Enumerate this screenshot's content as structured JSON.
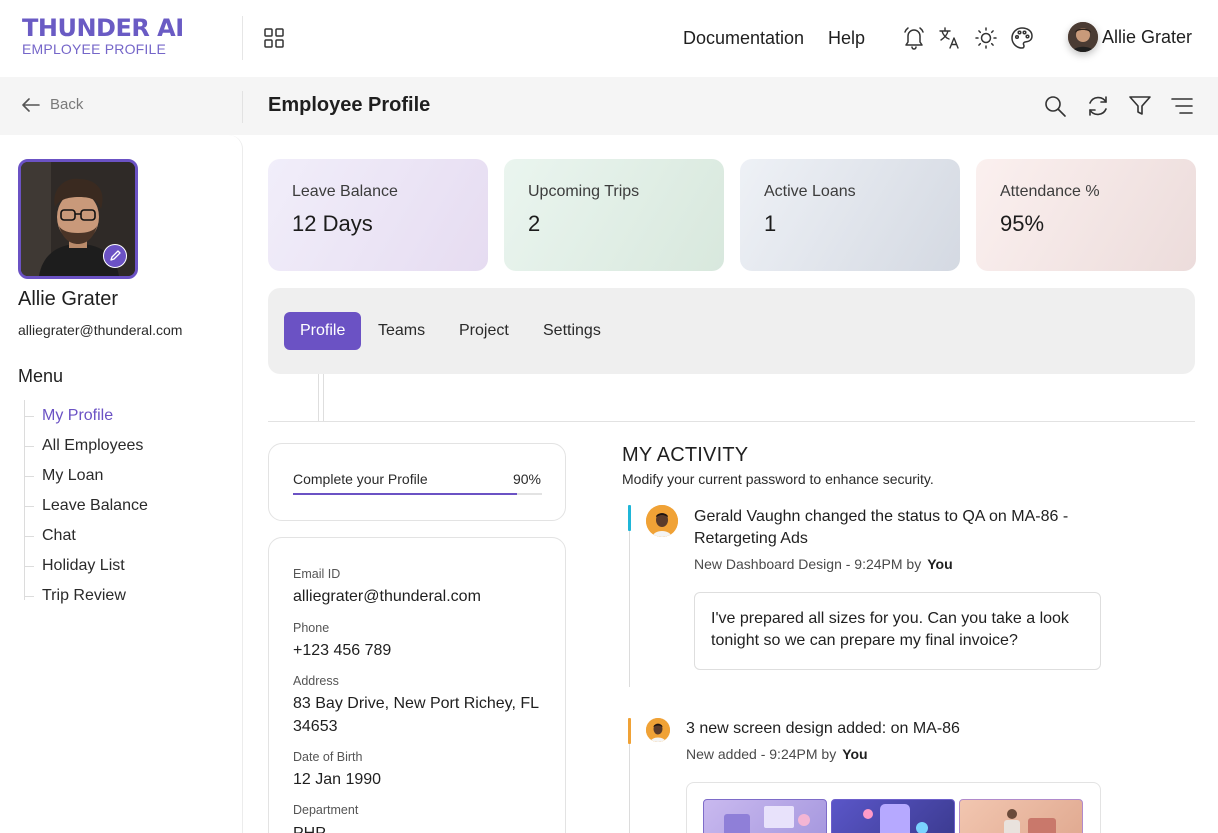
{
  "brand": {
    "title": "THUNDER AI",
    "subtitle": "EMPLOYEE PROFILE"
  },
  "header": {
    "nav": [
      "Documentation",
      "Help"
    ],
    "icons": [
      "notification-icon",
      "translate-icon",
      "sun-icon",
      "palette-icon"
    ],
    "user_name": "Allie Grater"
  },
  "subheader": {
    "back_label": "Back",
    "title": "Employee Profile",
    "icons": [
      "search-icon",
      "refresh-icon",
      "filter-icon",
      "menu-icon"
    ]
  },
  "sidebar": {
    "name": "Allie Grater",
    "email": "alliegrater@thunderal.com",
    "menu_title": "Menu",
    "items": [
      {
        "label": "My Profile",
        "active": true
      },
      {
        "label": "All Employees"
      },
      {
        "label": "My Loan"
      },
      {
        "label": "Leave Balance"
      },
      {
        "label": "Chat"
      },
      {
        "label": "Holiday List"
      },
      {
        "label": "Trip Review"
      }
    ]
  },
  "stats": [
    {
      "label": "Leave Balance",
      "value": "12 Days"
    },
    {
      "label": "Upcoming Trips",
      "value": "2"
    },
    {
      "label": "Active Loans",
      "value": "1"
    },
    {
      "label": "Attendance %",
      "value": "95%"
    }
  ],
  "tabs": [
    "Profile",
    "Teams",
    "Project",
    "Settings"
  ],
  "active_tab": "Profile",
  "profile_completion": {
    "label": "Complete your Profile",
    "percent_text": "90%",
    "value": 0.9
  },
  "details": [
    {
      "label": "Email ID",
      "value": "alliegrater@thunderal.com"
    },
    {
      "label": "Phone",
      "value": "+123 456 789"
    },
    {
      "label": "Address",
      "value": "83 Bay Drive, New Port Richey, FL 34653"
    },
    {
      "label": "Date of Birth",
      "value": "12 Jan 1990"
    },
    {
      "label": "Department",
      "value": "PHP"
    }
  ],
  "activity": {
    "title": "MY ACTIVITY",
    "subtitle": "Modify your current password to enhance security.",
    "items": [
      {
        "text": "Gerald Vaughn changed the status to QA on MA-86 - Retargeting Ads",
        "meta": "New Dashboard Design - 9:24PM by",
        "by": "You",
        "comment": "I've prepared all sizes for you. Can you take a look tonight so we can prepare my final invoice?"
      },
      {
        "text": "3 new screen design added: on MA-86",
        "meta": "New added - 9:24PM by",
        "by": "You"
      }
    ]
  },
  "colors": {
    "accent": "#6b52c4",
    "accent_bar_1": "#1fb6d8",
    "accent_bar_2": "#f0a236"
  }
}
